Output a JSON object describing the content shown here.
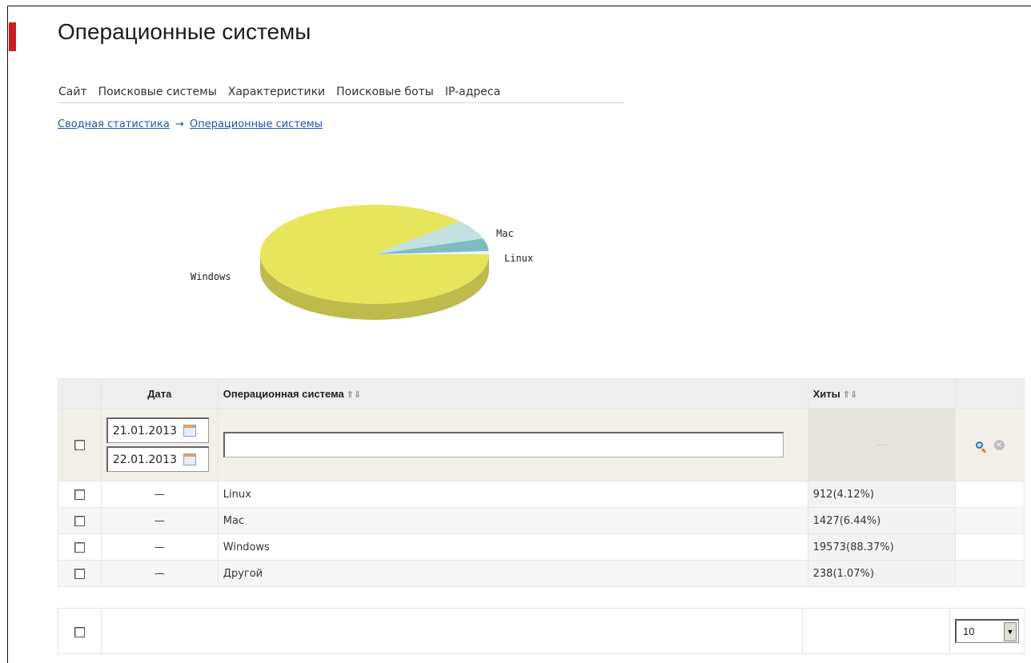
{
  "page": {
    "title": "Операционные системы"
  },
  "tabs": [
    "Сайт",
    "Поисковые системы",
    "Характеристики",
    "Поисковые боты",
    "IP-адреса"
  ],
  "breadcrumb": {
    "root": "Сводная статистика",
    "separator": "→",
    "current": "Операционные системы"
  },
  "chart_data": {
    "type": "pie",
    "slices": [
      {
        "label": "Windows",
        "value": 19573,
        "color": "#e6e55c"
      },
      {
        "label": "Mac",
        "value": 1427,
        "color": "#c4e0e2"
      },
      {
        "label": "Linux",
        "value": 912,
        "color": "#7fbcc2"
      },
      {
        "label": "",
        "value": 238,
        "color": "#eef6f6"
      }
    ]
  },
  "table": {
    "headers": {
      "date": "Дата",
      "os": "Операционная система",
      "hits": "Хиты",
      "sort_arrows": "⇑⇓"
    },
    "filter": {
      "date_from": "21.01.2013",
      "date_to": "22.01.2013",
      "os_value": "",
      "hits_placeholder": "—"
    },
    "rows": [
      {
        "date": "—",
        "os": "Linux",
        "hits": "912(4.12%)"
      },
      {
        "date": "—",
        "os": "Mac",
        "hits": "1427(6.44%)"
      },
      {
        "date": "—",
        "os": "Windows",
        "hits": "19573(88.37%)"
      },
      {
        "date": "—",
        "os": "Другой",
        "hits": "238(1.07%)"
      }
    ]
  },
  "footer": {
    "per_page": "10",
    "dropdown_arrow": "▼"
  },
  "icons": {
    "close": "×"
  }
}
